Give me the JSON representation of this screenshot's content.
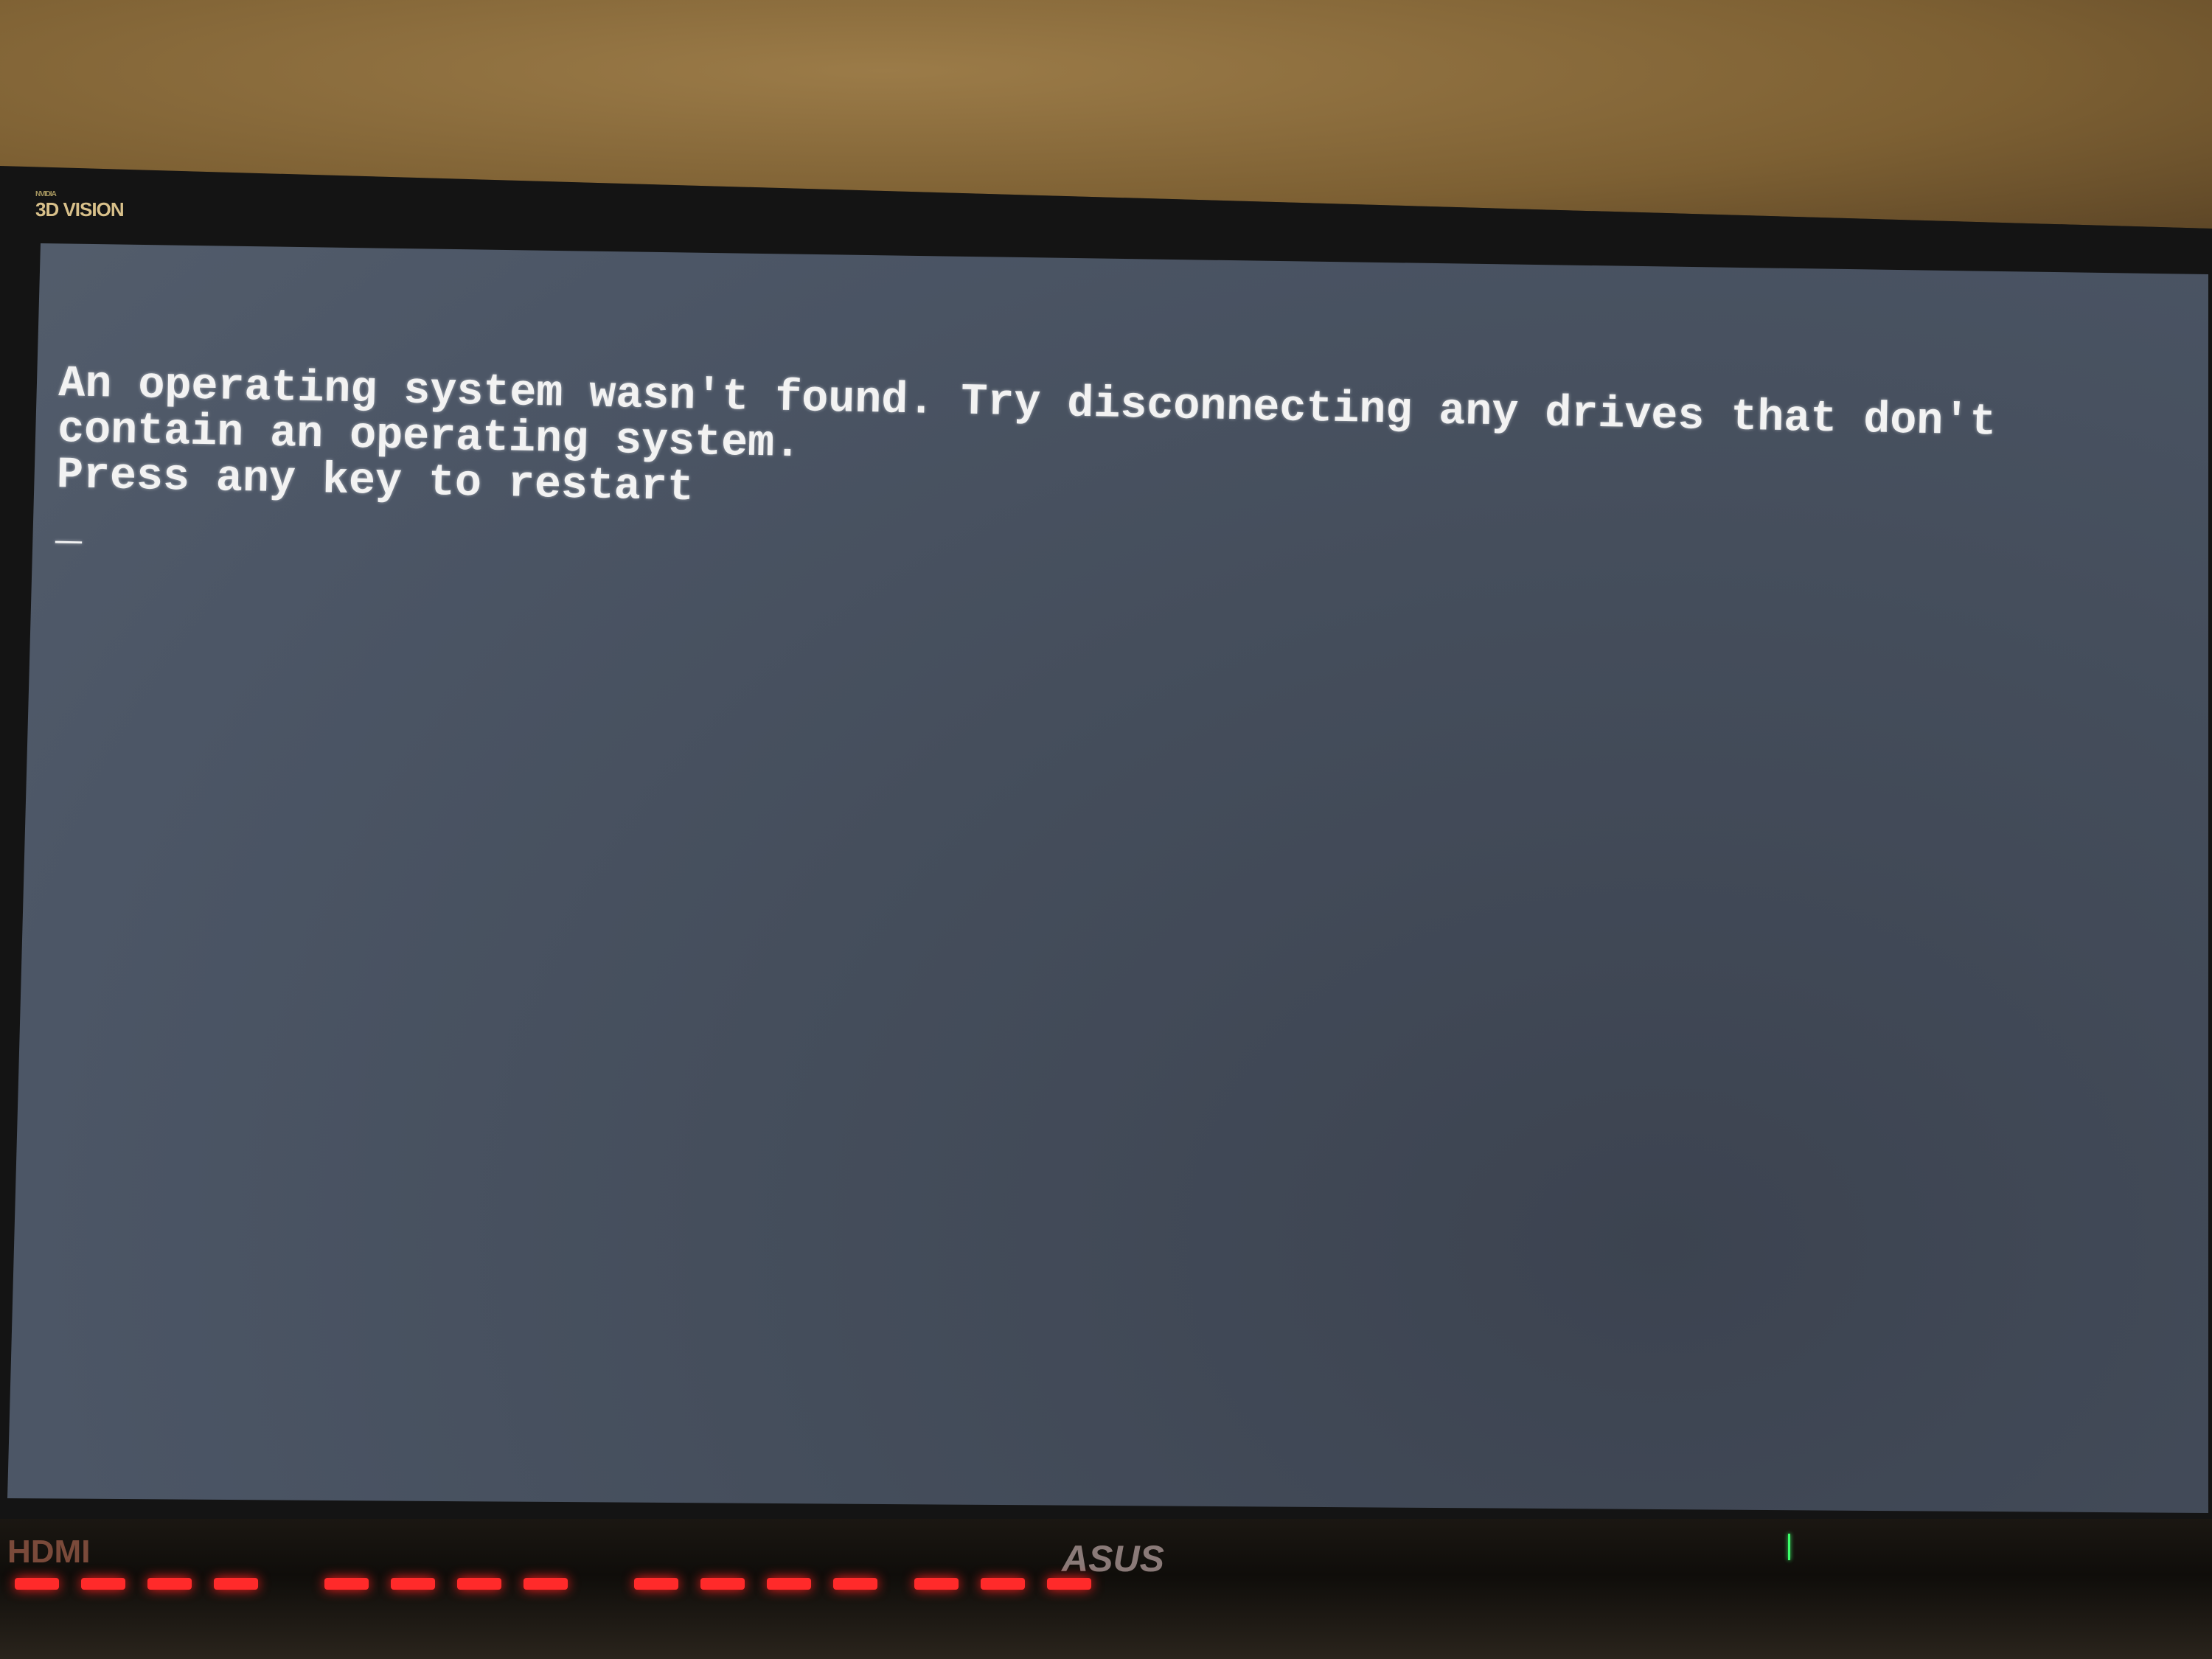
{
  "monitor": {
    "brand_logo": "3D VISION",
    "brand_logo_small": "NVIDIA",
    "input_label": "HDMI",
    "manufacturer": "ASUS"
  },
  "console": {
    "lines": [
      "An operating system wasn't found. Try disconnecting any drives that don't",
      "contain an operating system.",
      "Press any key to restart"
    ],
    "cursor": "_"
  },
  "colors": {
    "screen_background": "#4c5666",
    "text": "#f2f2f2",
    "keyboard_backlight": "#ff2a2a",
    "power_led": "#3cff6a"
  }
}
